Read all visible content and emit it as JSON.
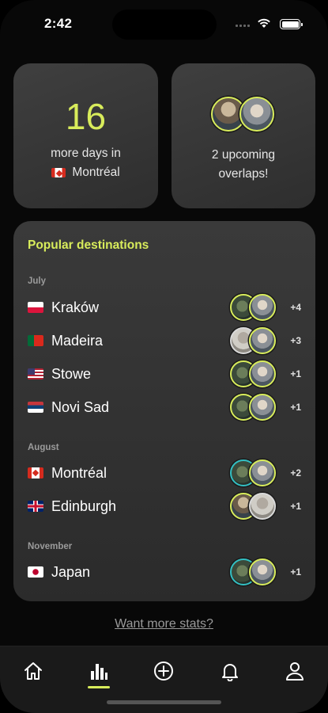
{
  "status_bar": {
    "time": "2:42"
  },
  "days_card": {
    "number": "16",
    "text": "more days in",
    "city": "Montréal"
  },
  "overlaps_card": {
    "text_line1": "2 upcoming",
    "text_line2": "overlaps!"
  },
  "destinations": {
    "title": "Popular destinations",
    "months": [
      {
        "label": "July",
        "items": [
          {
            "name": "Kraków",
            "count": "+4"
          },
          {
            "name": "Madeira",
            "count": "+3"
          },
          {
            "name": "Stowe",
            "count": "+1"
          },
          {
            "name": "Novi Sad",
            "count": "+1"
          }
        ]
      },
      {
        "label": "August",
        "items": [
          {
            "name": "Montréal",
            "count": "+2"
          },
          {
            "name": "Edinburgh",
            "count": "+1"
          }
        ]
      },
      {
        "label": "November",
        "items": [
          {
            "name": "Japan",
            "count": "+1"
          }
        ]
      }
    ]
  },
  "more_stats_link": "Want more stats?",
  "tabs": [
    {
      "name": "home",
      "icon": "house-icon"
    },
    {
      "name": "stats",
      "icon": "bar-chart-icon",
      "active": true
    },
    {
      "name": "add",
      "icon": "plus-circle-icon"
    },
    {
      "name": "notifications",
      "icon": "bell-icon"
    },
    {
      "name": "profile",
      "icon": "person-icon"
    }
  ],
  "colors": {
    "accent": "#d8ec5b",
    "background": "#080808",
    "card": "#353535"
  }
}
